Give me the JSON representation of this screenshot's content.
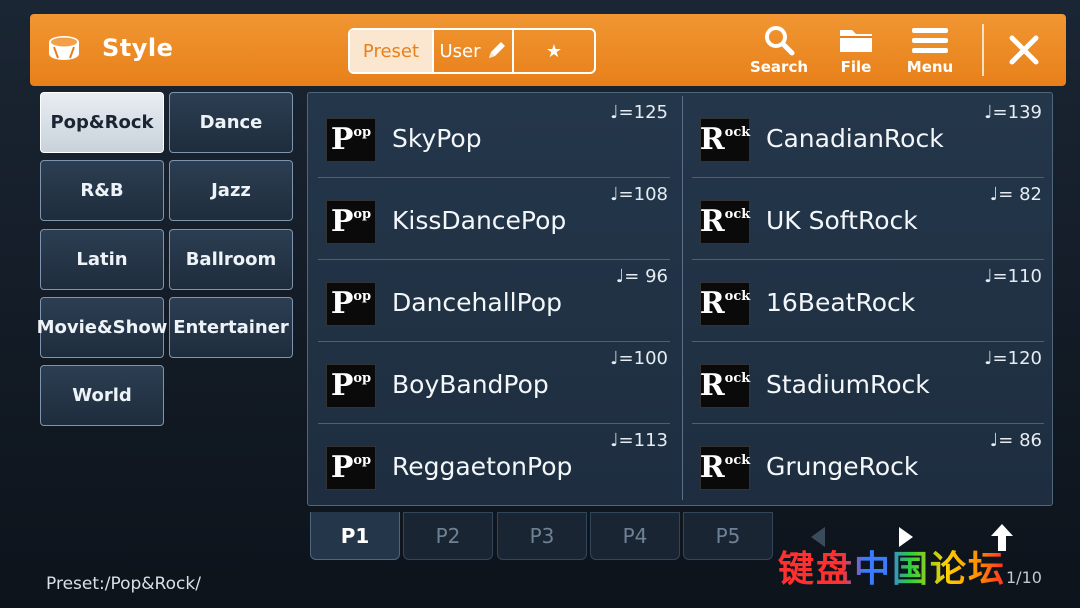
{
  "header": {
    "title": "Style",
    "tabs": {
      "preset": "Preset",
      "user": "User",
      "favorite": "★"
    },
    "buttons": {
      "search": "Search",
      "file": "File",
      "menu": "Menu"
    },
    "accent": "#e8801a"
  },
  "categories": [
    {
      "label": "Pop&Rock",
      "selected": true
    },
    {
      "label": "Dance"
    },
    {
      "label": "R&B"
    },
    {
      "label": "Jazz"
    },
    {
      "label": "Latin"
    },
    {
      "label": "Ballroom"
    },
    {
      "label": "Movie&Show"
    },
    {
      "label": "Entertainer"
    },
    {
      "label": "World"
    }
  ],
  "styles": [
    {
      "name": "SkyPop",
      "tempo": "♩=125",
      "icon": "Pop"
    },
    {
      "name": "CanadianRock",
      "tempo": "♩=139",
      "icon": "Rock"
    },
    {
      "name": "KissDancePop",
      "tempo": "♩=108",
      "icon": "Pop"
    },
    {
      "name": "UK SoftRock",
      "tempo": "♩= 82",
      "icon": "Rock"
    },
    {
      "name": "DancehallPop",
      "tempo": "♩= 96",
      "icon": "Pop"
    },
    {
      "name": "16BeatRock",
      "tempo": "♩=110",
      "icon": "Rock"
    },
    {
      "name": "BoyBandPop",
      "tempo": "♩=100",
      "icon": "Pop"
    },
    {
      "name": "StadiumRock",
      "tempo": "♩=120",
      "icon": "Rock"
    },
    {
      "name": "ReggaetonPop",
      "tempo": "♩=113",
      "icon": "Pop"
    },
    {
      "name": "GrungeRock",
      "tempo": "♩= 86",
      "icon": "Rock"
    }
  ],
  "pages": [
    "P1",
    "P2",
    "P3",
    "P4",
    "P5"
  ],
  "active_page": "P1",
  "status": {
    "path": "Preset:/Pop&Rock/",
    "page_count": "1/10"
  },
  "watermark": "键盘中国论坛"
}
